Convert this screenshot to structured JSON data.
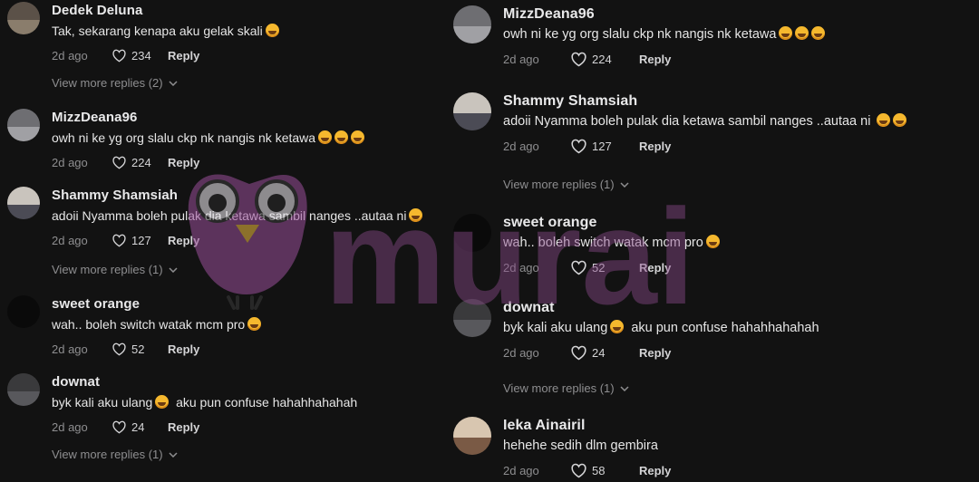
{
  "left_column": {
    "comments": [
      {
        "username": "Dedek Deluna",
        "text": "Tak, sekarang kenapa aku gelak skali",
        "emojis": [
          "grin"
        ],
        "time": "2d ago",
        "likes": "234",
        "reply": "Reply",
        "view_more": "View more replies (2)"
      },
      {
        "username": "MizzDeana96",
        "text": "owh ni ke yg org slalu ckp nk nangis nk ketawa",
        "emojis": [
          "rofl",
          "rofl",
          "rofl"
        ],
        "time": "2d ago",
        "likes": "224",
        "reply": "Reply"
      },
      {
        "username": "Shammy Shamsiah",
        "text": "adoii Nyamma boleh pulak dia ketawa sambil nanges ..autaa ni",
        "emojis": [
          "rofl"
        ],
        "time": "2d ago",
        "likes": "127",
        "reply": "Reply",
        "view_more": "View more replies (1)"
      },
      {
        "username": "sweet orange",
        "text": "wah.. boleh switch watak mcm pro",
        "emojis": [
          "rofl"
        ],
        "time": "2d ago",
        "likes": "52",
        "reply": "Reply"
      },
      {
        "username": "downat",
        "text": "byk kali aku ulang",
        "text_after": "aku pun confuse hahahhahahah",
        "emojis": [
          "joy"
        ],
        "time": "2d ago",
        "likes": "24",
        "reply": "Reply",
        "view_more": "View more replies (1)"
      }
    ]
  },
  "right_column": {
    "comments": [
      {
        "username": "MizzDeana96",
        "text": "owh ni ke yg org slalu ckp nk nangis nk ketawa",
        "emojis": [
          "rofl",
          "rofl",
          "rofl"
        ],
        "time": "2d ago",
        "likes": "224",
        "reply": "Reply"
      },
      {
        "username": "Shammy Shamsiah",
        "text": "adoii Nyamma boleh pulak dia ketawa sambil nanges ..autaa ni",
        "emojis": [
          "rofl",
          "rofl"
        ],
        "time": "2d ago",
        "likes": "127",
        "reply": "Reply",
        "view_more": "View more replies (1)"
      },
      {
        "username": "sweet orange",
        "text": "wah.. boleh switch watak mcm pro",
        "emojis": [
          "rofl"
        ],
        "time": "2d ago",
        "likes": "52",
        "reply": "Reply"
      },
      {
        "username": "downat",
        "text": "byk kali aku ulang",
        "text_after": "aku pun confuse hahahhahahah",
        "emojis": [
          "joy"
        ],
        "time": "2d ago",
        "likes": "24",
        "reply": "Reply",
        "view_more": "View more replies (1)"
      },
      {
        "username": "Ieka Ainairil",
        "text": "hehehe sedih dlm gembira",
        "emojis": [],
        "time": "2d ago",
        "likes": "58",
        "reply": "Reply"
      }
    ]
  },
  "watermark": {
    "text": "murai"
  },
  "colors": {
    "background": "#121212",
    "muted": "#8e8e90",
    "watermark": "#8a4a8a"
  }
}
